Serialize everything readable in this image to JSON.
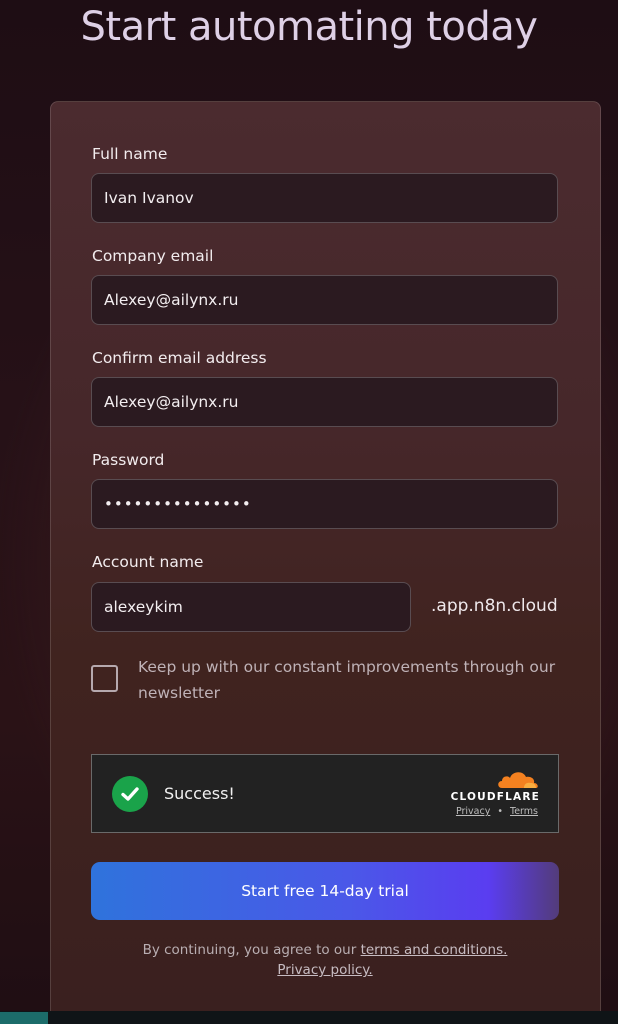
{
  "heading": "Start automating today",
  "form": {
    "full_name": {
      "label": "Full name",
      "value": "Ivan Ivanov"
    },
    "company_email": {
      "label": "Company email",
      "value": "Alexey@ailynx.ru"
    },
    "confirm_email": {
      "label": "Confirm email address",
      "value": "Alexey@ailynx.ru"
    },
    "password": {
      "label": "Password",
      "value": "•••••••••••••••"
    },
    "account_name": {
      "label": "Account name",
      "value": "alexeykim",
      "suffix": ".app.n8n.cloud"
    },
    "newsletter": {
      "checked": false,
      "label": "Keep up with our constant improvements through our newsletter"
    }
  },
  "captcha": {
    "status": "Success!",
    "provider": "CLOUDFLARE",
    "privacy_link": "Privacy",
    "separator": "•",
    "terms_link": "Terms",
    "success_color": "#1aa34a",
    "brand_color": "#f48120"
  },
  "cta": {
    "label": "Start free 14-day trial"
  },
  "legal": {
    "prefix": "By continuing, you agree to our ",
    "terms_link": "terms and conditions.",
    "privacy_link": "Privacy policy."
  }
}
